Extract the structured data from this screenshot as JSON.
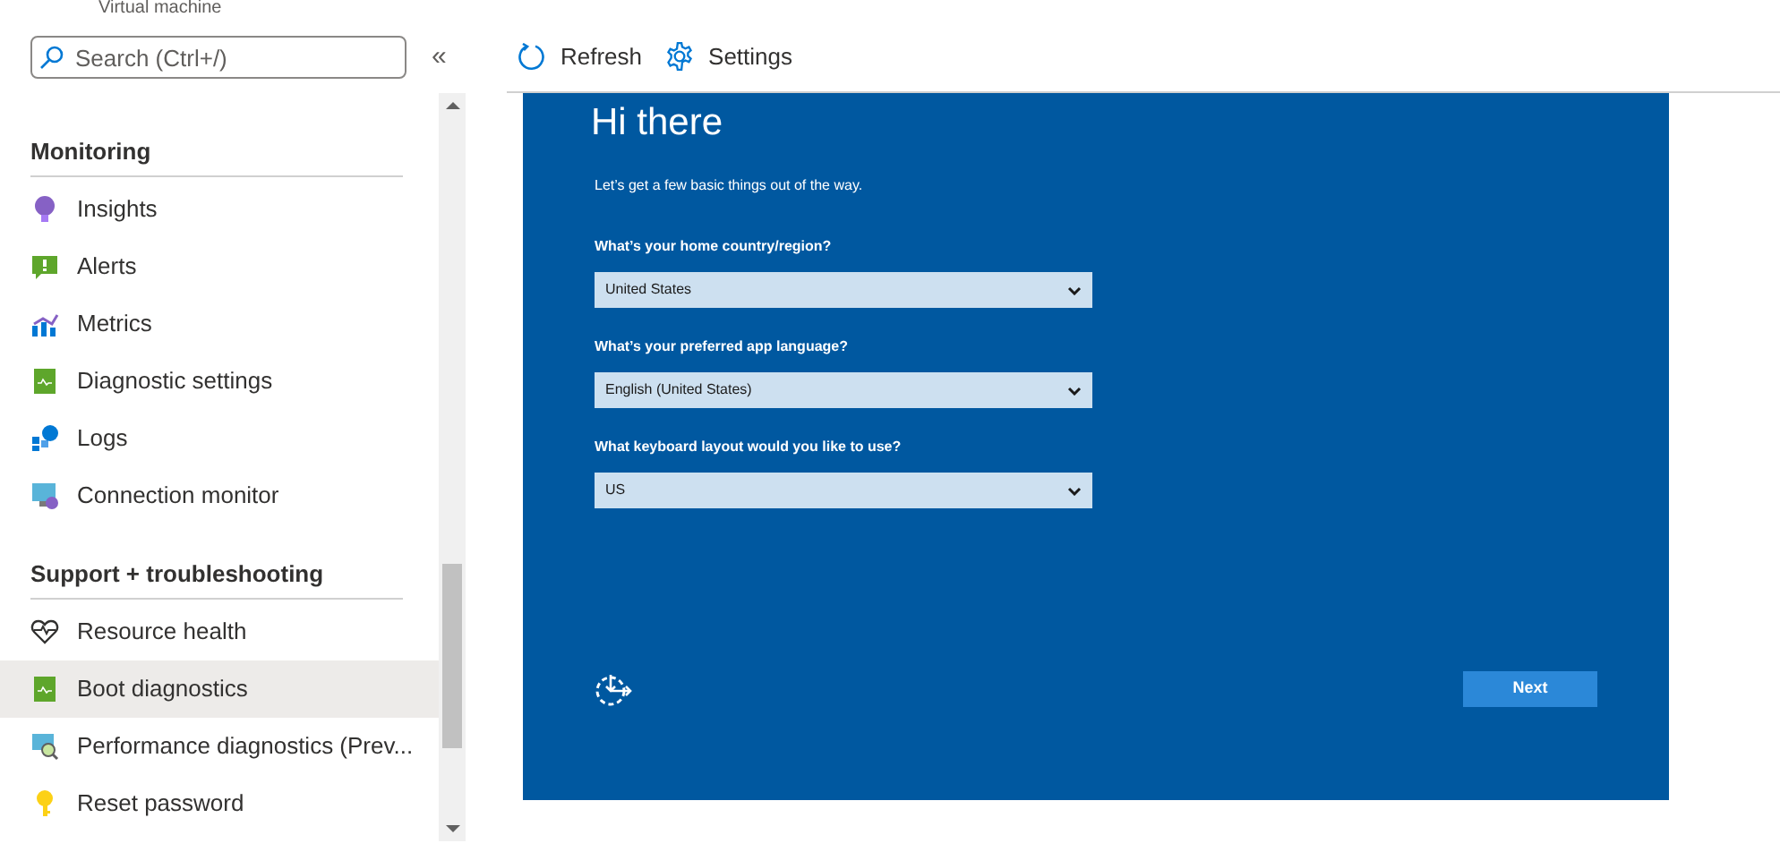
{
  "header": {
    "subtitle": "Virtual machine"
  },
  "sidebar": {
    "search": {
      "placeholder": "Search (Ctrl+/)"
    },
    "collapse": "«",
    "sections": [
      {
        "title": "Monitoring",
        "items": [
          {
            "label": "Insights",
            "selected": false
          },
          {
            "label": "Alerts",
            "selected": false
          },
          {
            "label": "Metrics",
            "selected": false
          },
          {
            "label": "Diagnostic settings",
            "selected": false
          },
          {
            "label": "Logs",
            "selected": false
          },
          {
            "label": "Connection monitor",
            "selected": false
          }
        ]
      },
      {
        "title": "Support + troubleshooting",
        "items": [
          {
            "label": "Resource health",
            "selected": false
          },
          {
            "label": "Boot diagnostics",
            "selected": true
          },
          {
            "label": "Performance diagnostics (Prev...",
            "selected": false
          },
          {
            "label": "Reset password",
            "selected": false
          }
        ]
      }
    ]
  },
  "toolbar": [
    {
      "label": "Refresh"
    },
    {
      "label": "Settings"
    }
  ],
  "screen": {
    "title": "Hi there",
    "subtitle": "Let’s get a few basic things out of the way.",
    "fields": [
      {
        "label": "What’s your home country/region?",
        "value": "United States"
      },
      {
        "label": "What’s your preferred app language?",
        "value": "English (United States)"
      },
      {
        "label": "What keyboard layout would you like to use?",
        "value": "US"
      }
    ],
    "next_button": "Next"
  }
}
